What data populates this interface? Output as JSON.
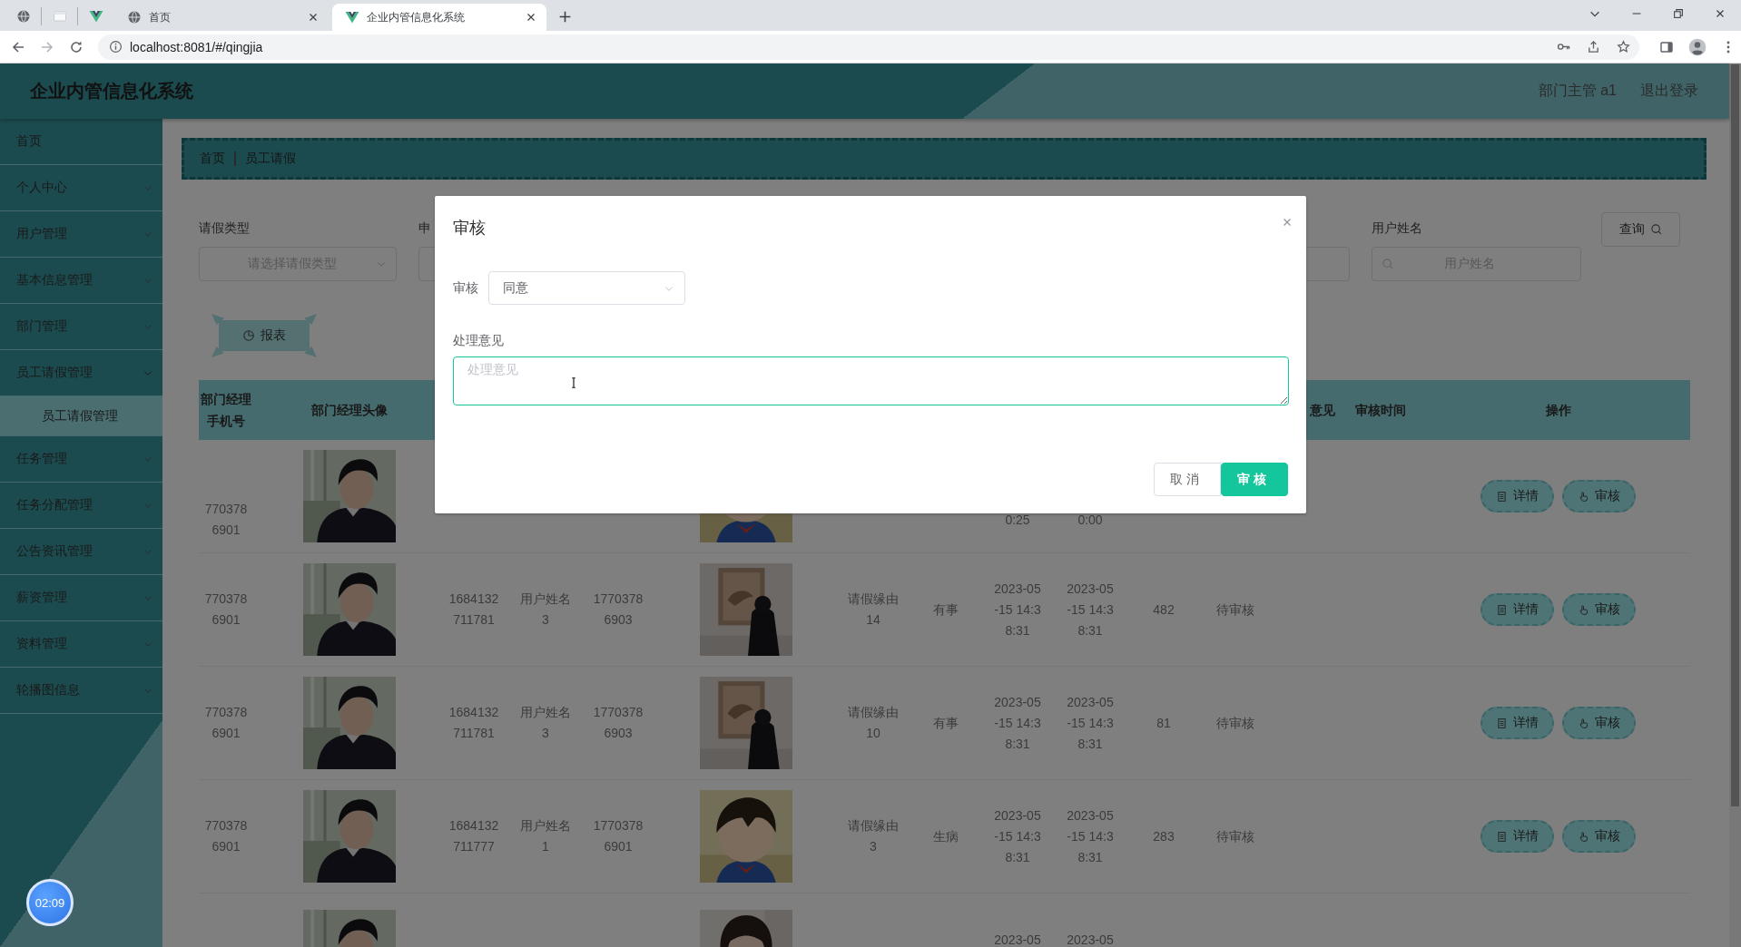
{
  "browser": {
    "tabs": [
      {
        "kind": "pinned",
        "selected": false
      },
      {
        "kind": "pinned",
        "selected": false
      },
      {
        "kind": "pinned",
        "selected": false
      },
      {
        "kind": "page",
        "title": "首页",
        "selected": false
      },
      {
        "kind": "page",
        "title": "企业内管信息化系统",
        "selected": true
      }
    ],
    "url": "localhost:8081/#/qingjia"
  },
  "header": {
    "title": "企业内管信息化系统",
    "user": "部门主管 a1",
    "logout": "退出登录"
  },
  "sidebar": {
    "items": [
      {
        "label": "首页",
        "kind": "link"
      },
      {
        "label": "个人中心",
        "kind": "menu",
        "expanded": false
      },
      {
        "label": "用户管理",
        "kind": "menu",
        "expanded": false
      },
      {
        "label": "基本信息管理",
        "kind": "menu",
        "expanded": false
      },
      {
        "label": "部门管理",
        "kind": "menu",
        "expanded": false
      },
      {
        "label": "员工请假管理",
        "kind": "menu",
        "expanded": true,
        "children": [
          {
            "label": "员工请假管理",
            "selected": true
          }
        ]
      },
      {
        "label": "任务管理",
        "kind": "menu",
        "expanded": false
      },
      {
        "label": "任务分配管理",
        "kind": "menu",
        "expanded": false
      },
      {
        "label": "公告资讯管理",
        "kind": "menu",
        "expanded": false
      },
      {
        "label": "薪资管理",
        "kind": "menu",
        "expanded": false
      },
      {
        "label": "资料管理",
        "kind": "menu",
        "expanded": false
      },
      {
        "label": "轮播图信息",
        "kind": "menu",
        "expanded": false
      }
    ]
  },
  "breadcrumb": [
    "首页",
    "员工请假"
  ],
  "filters": [
    {
      "kind": "select",
      "label": "请假类型",
      "placeholder": "请选择请假类型"
    },
    {
      "kind": "input",
      "label": "申"
    },
    {
      "kind": "input"
    },
    {
      "kind": "search",
      "label": "用户姓名",
      "placeholder": "用户姓名"
    }
  ],
  "search_button": "查询",
  "report_button": "报表",
  "table": {
    "columns": [
      "部门经理手机号",
      "部门经理头像",
      null,
      null,
      null,
      null,
      null,
      null,
      null,
      null,
      null,
      null,
      "意见",
      "审核时间",
      "操作"
    ],
    "rows": [
      {
        "cells": [
          "7703786901",
          {
            "kind": "picture"
          },
          null,
          null,
          null,
          {
            "kind": "picture"
          },
          null,
          null,
          "0:25",
          "0:00",
          null,
          null,
          null,
          null
        ],
        "actions": [
          "详情",
          "审核"
        ]
      },
      {
        "cells": [
          "7703786901",
          {
            "kind": "picture"
          },
          "1684132711781",
          "用户姓名3",
          "17703786903",
          {
            "kind": "picture"
          },
          "请假缘由14",
          "有事",
          "2023-05-15 14:38:31",
          "2023-05-15 14:38:31",
          "482",
          "待审核",
          null,
          null
        ],
        "actions": [
          "详情",
          "审核"
        ]
      },
      {
        "cells": [
          "7703786901",
          {
            "kind": "picture"
          },
          "1684132711781",
          "用户姓名3",
          "17703786903",
          {
            "kind": "picture"
          },
          "请假缘由10",
          "有事",
          "2023-05-15 14:38:31",
          "2023-05-15 14:38:31",
          "81",
          "待审核",
          null,
          null
        ],
        "actions": [
          "详情",
          "审核"
        ]
      },
      {
        "cells": [
          "7703786901",
          {
            "kind": "picture"
          },
          "1684132711777",
          "用户姓名1",
          "17703786901",
          {
            "kind": "picture"
          },
          "请假缘由3",
          "生病",
          "2023-05-15 14:38:31",
          "2023-05-15 14:38:31",
          "283",
          "待审核",
          null,
          null
        ],
        "actions": [
          "详情",
          "审核"
        ]
      },
      {
        "cells": [
          null,
          {
            "kind": "picture"
          },
          null,
          null,
          null,
          {
            "kind": "picture"
          },
          null,
          null,
          "2023-05",
          "2023-05",
          null,
          null,
          null,
          null
        ]
      }
    ]
  },
  "modal": {
    "title": "审核",
    "fields": [
      {
        "kind": "select",
        "label": "审核",
        "value": "同意"
      },
      {
        "kind": "textarea",
        "label": "处理意见",
        "placeholder": "处理意见",
        "focused": true
      }
    ],
    "buttons": [
      {
        "kind": "default",
        "label": "取消"
      },
      {
        "kind": "primary",
        "label": "审核"
      }
    ]
  },
  "recorder_timer": "02:09"
}
